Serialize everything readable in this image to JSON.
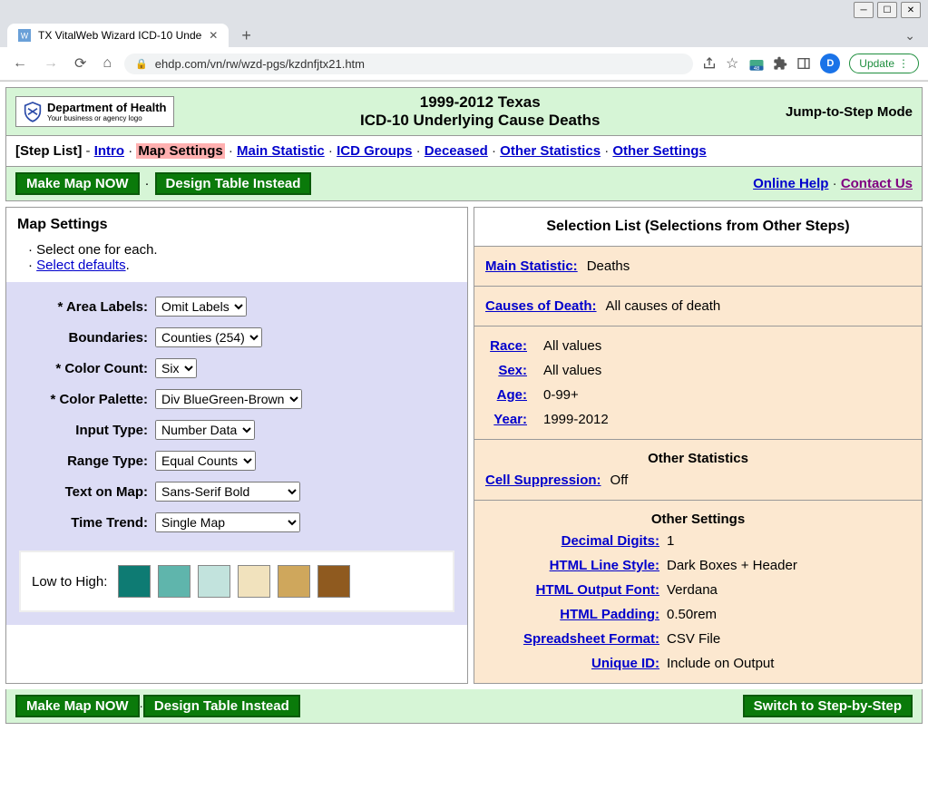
{
  "browser": {
    "tab_title": "TX VitalWeb Wizard ICD-10 Unde",
    "url": "ehdp.com/vn/rw/wzd-pgs/kzdnfjtx21.htm",
    "update_label": "Update",
    "avatar_letter": "D",
    "ext_badge": "48"
  },
  "header": {
    "dept_line": "Department of Health",
    "dept_sub": "Your business or agency logo",
    "title_line1": "1999-2012 Texas",
    "title_line2": "ICD-10 Underlying Cause Deaths",
    "mode": "Jump-to-Step Mode"
  },
  "nav": {
    "step_list": "[Step List]",
    "intro": "Intro",
    "map_settings": "Map Settings",
    "main_statistic": "Main Statistic",
    "icd_groups": "ICD Groups",
    "deceased": "Deceased",
    "other_statistics": "Other Statistics",
    "other_settings": "Other Settings"
  },
  "actions": {
    "make_map": "Make Map NOW",
    "design_table": "Design Table Instead",
    "online_help": "Online Help",
    "contact_us": "Contact Us",
    "switch_mode": "Switch to Step-by-Step"
  },
  "left": {
    "heading": "Map Settings",
    "intro1": "· Select one for each.",
    "intro2_prefix": "· ",
    "intro2_link": "Select defaults",
    "intro2_suffix": ".",
    "settings": {
      "area_labels": {
        "label": "* Area Labels:",
        "value": "Omit Labels"
      },
      "boundaries": {
        "label": "Boundaries:",
        "value": "Counties (254)"
      },
      "color_count": {
        "label": "* Color Count:",
        "value": "Six"
      },
      "color_palette": {
        "label": "* Color Palette:",
        "value": "Div BlueGreen-Brown"
      },
      "input_type": {
        "label": "Input Type:",
        "value": "Number Data"
      },
      "range_type": {
        "label": "Range Type:",
        "value": "Equal Counts"
      },
      "text_on_map": {
        "label": "Text on Map:",
        "value": "Sans-Serif Bold"
      },
      "time_trend": {
        "label": "Time Trend:",
        "value": "Single Map"
      }
    },
    "palette_label": "Low to High:",
    "palette_colors": [
      "#0e7b73",
      "#5fb5ac",
      "#c2e3dd",
      "#f1e2bd",
      "#cfa75c",
      "#8f5a1f"
    ]
  },
  "right": {
    "heading": "Selection List (Selections from Other Steps)",
    "main_stat": {
      "label": "Main Statistic:",
      "value": "Deaths"
    },
    "causes": {
      "label": "Causes of Death:",
      "value": "All causes of death"
    },
    "race": {
      "label": "Race:",
      "value": "All values"
    },
    "sex": {
      "label": "Sex:",
      "value": "All values"
    },
    "age": {
      "label": "Age:",
      "value": "0-99+"
    },
    "year": {
      "label": "Year:",
      "value": "1999-2012"
    },
    "other_stats_head": "Other Statistics",
    "cell_supp": {
      "label": "Cell Suppression:",
      "value": "Off"
    },
    "other_settings_head": "Other Settings",
    "decimal": {
      "label": "Decimal Digits:",
      "value": "1"
    },
    "line_style": {
      "label": "HTML Line Style:",
      "value": "Dark Boxes + Header"
    },
    "output_font": {
      "label": "HTML Output Font:",
      "value": "Verdana"
    },
    "padding": {
      "label": "HTML Padding:",
      "value": "0.50rem"
    },
    "spreadsheet": {
      "label": "Spreadsheet Format:",
      "value": "CSV File"
    },
    "unique_id": {
      "label": "Unique ID:",
      "value": "Include on Output"
    }
  }
}
